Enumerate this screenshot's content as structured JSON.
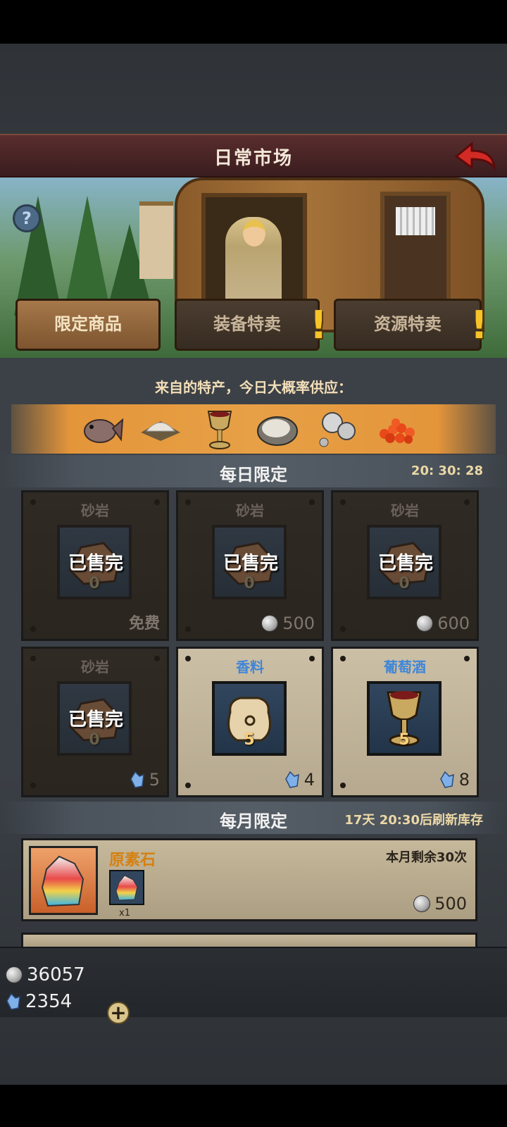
{
  "header": {
    "title": "日常市场"
  },
  "tabs": [
    {
      "label": "限定商品",
      "active": true,
      "alert": false
    },
    {
      "label": "装备特卖",
      "active": false,
      "alert": true
    },
    {
      "label": "资源特卖",
      "active": false,
      "alert": true
    }
  ],
  "help_label": "?",
  "specialty": {
    "title": "来自的特产，今日大概率供应：",
    "items": [
      "fish-icon",
      "salt-icon",
      "wine-goblet-icon",
      "oyster-icon",
      "pearls-icon",
      "caviar-icon"
    ]
  },
  "daily": {
    "title": "每日限定",
    "timer": "20: 30: 28",
    "cards": [
      {
        "name": "砂岩",
        "count": "0",
        "sold": "已售完",
        "price": "免费",
        "currency": "free",
        "icon": "sandstone-icon"
      },
      {
        "name": "砂岩",
        "count": "0",
        "sold": "已售完",
        "price": "500",
        "currency": "coin",
        "icon": "sandstone-icon"
      },
      {
        "name": "砂岩",
        "count": "0",
        "sold": "已售完",
        "price": "600",
        "currency": "coin",
        "icon": "sandstone-icon"
      },
      {
        "name": "砂岩",
        "count": "0",
        "sold": "已售完",
        "price": "5",
        "currency": "gem",
        "icon": "sandstone-icon"
      },
      {
        "name": "香料",
        "count": "5",
        "sold": "",
        "price": "4",
        "currency": "gem",
        "icon": "spice-sack-icon"
      },
      {
        "name": "葡萄酒",
        "count": "5",
        "sold": "",
        "price": "8",
        "currency": "gem",
        "icon": "wine-goblet-icon"
      }
    ]
  },
  "monthly": {
    "title": "每月限定",
    "timer": "17天 20:30后刷新库存",
    "items": [
      {
        "name": "原素石",
        "remaining": "本月剩余30次",
        "qty": "x1",
        "price": "500",
        "currency": "coin",
        "icon": "element-stone-icon"
      }
    ]
  },
  "resources": {
    "coins": "36057",
    "gems": "2354",
    "add_label": "+"
  },
  "colors": {
    "header_bg": "#4a2426",
    "tab_active": "#a6784a",
    "specialty_band": "#e7a046",
    "available_name": "#3f86d8",
    "free_price": "#4f8a3a",
    "monthly_name": "#d58010"
  }
}
